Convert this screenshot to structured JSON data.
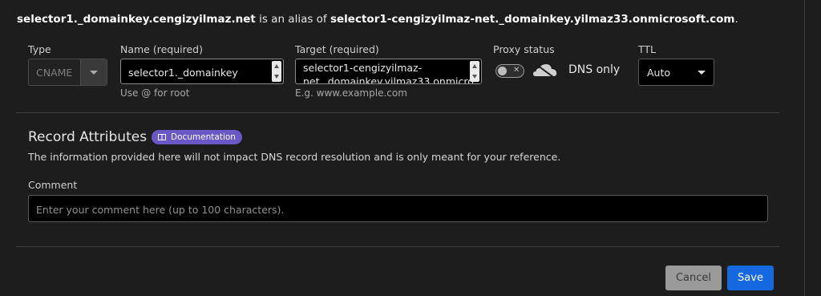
{
  "alias": {
    "name": "selector1._domainkey.cengizyilmaz.net",
    "middle": " is an alias of ",
    "target": "selector1-cengizyilmaz-net._domainkey.yilmaz33.onmicrosoft.com",
    "end": "."
  },
  "type": {
    "label": "Type",
    "value": "CNAME"
  },
  "name": {
    "label": "Name (required)",
    "value": "selector1._domainkey",
    "hint": "Use @ for root"
  },
  "target": {
    "label": "Target (required)",
    "line1": "selector1-cengizyilmaz-",
    "line2": "net._domainkey.yilmaz33.onmicro",
    "hint": "E.g. www.example.com"
  },
  "proxy": {
    "label": "Proxy status",
    "toggle_mark": "✕",
    "status": "DNS only",
    "enabled": false,
    "icon": "cloud-icon"
  },
  "ttl": {
    "label": "TTL",
    "value": "Auto"
  },
  "record_attributes": {
    "title": "Record Attributes",
    "doc_badge": "Documentation",
    "doc_icon": "book-icon",
    "description": "The information provided here will not impact DNS record resolution and is only meant for your reference."
  },
  "comment": {
    "label": "Comment",
    "placeholder": "Enter your comment here (up to 100 characters)."
  },
  "actions": {
    "cancel": "Cancel",
    "save": "Save"
  },
  "colors": {
    "badge": "#6b58c7",
    "save": "#1668e0",
    "cancel": "#9a9a9a"
  }
}
